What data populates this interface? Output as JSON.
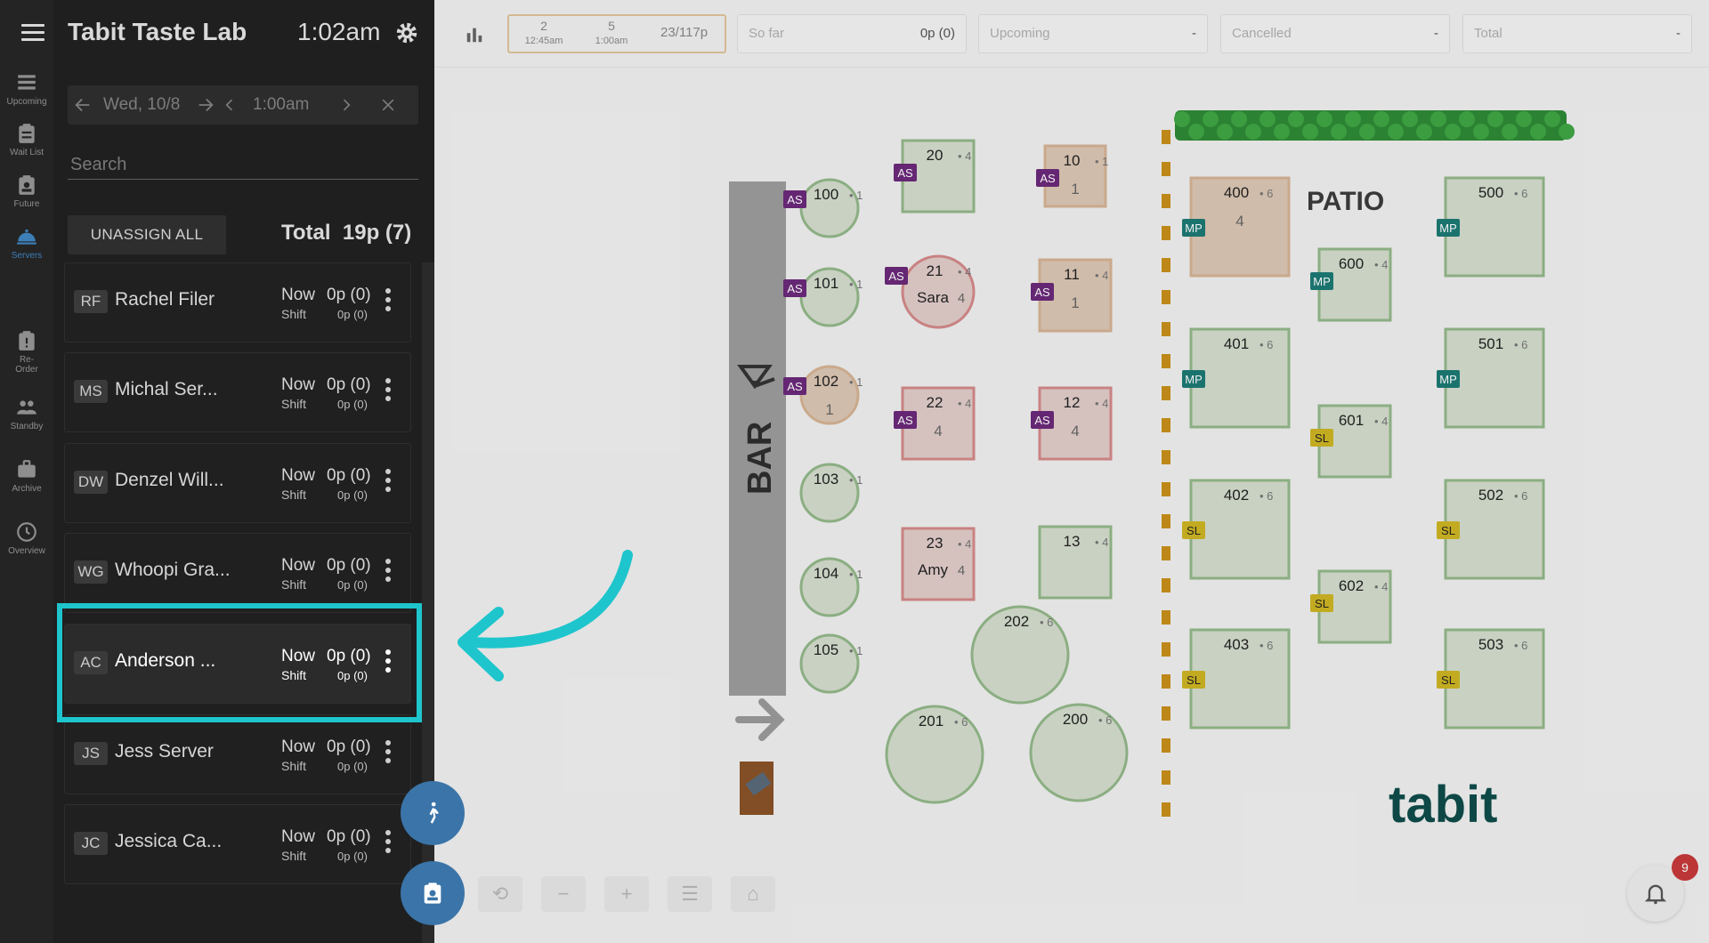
{
  "app": {
    "title": "Tabit Taste Lab",
    "time": "1:02am"
  },
  "rail": [
    {
      "label": "Upcoming",
      "icon": "list-icon"
    },
    {
      "label": "Wait List",
      "icon": "clipboard-icon"
    },
    {
      "label": "Future",
      "icon": "clipboard-user-icon"
    },
    {
      "label": "Servers",
      "icon": "cloche-icon",
      "active": true
    },
    {
      "label": "Re-Order",
      "icon": "clipboard-alert-icon"
    },
    {
      "label": "Standby",
      "icon": "people-icon"
    },
    {
      "label": "Archive",
      "icon": "briefcase-icon"
    },
    {
      "label": "Overview",
      "icon": "clock-icon"
    }
  ],
  "datebar": {
    "date": "Wed, 10/8",
    "time": "1:00am"
  },
  "search": {
    "placeholder": "Search"
  },
  "actions": {
    "unassign_all": "UNASSIGN ALL",
    "total_label": "Total",
    "total_value": "19p (7)"
  },
  "servers": [
    {
      "initials": "RF",
      "name": "Rachel Filer",
      "now_label": "Now",
      "now_value": "0p (0)",
      "shift_label": "Shift",
      "shift_value": "0p (0)"
    },
    {
      "initials": "MS",
      "name": "Michal Ser...",
      "now_label": "Now",
      "now_value": "0p (0)",
      "shift_label": "Shift",
      "shift_value": "0p (0)"
    },
    {
      "initials": "DW",
      "name": "Denzel Will...",
      "now_label": "Now",
      "now_value": "0p (0)",
      "shift_label": "Shift",
      "shift_value": "0p (0)"
    },
    {
      "initials": "WG",
      "name": "Whoopi Gra...",
      "now_label": "Now",
      "now_value": "0p (0)",
      "shift_label": "Shift",
      "shift_value": "0p (0)"
    },
    {
      "initials": "AC",
      "name": "Anderson ...",
      "now_label": "Now",
      "now_value": "0p (0)",
      "shift_label": "Shift",
      "shift_value": "0p (0)",
      "highlighted": true
    },
    {
      "initials": "JS",
      "name": "Jess Server",
      "now_label": "Now",
      "now_value": "0p (0)",
      "shift_label": "Shift",
      "shift_value": "0p (0)"
    },
    {
      "initials": "JC",
      "name": "Jessica Ca...",
      "now_label": "Now",
      "now_value": "0p (0)",
      "shift_label": "Shift",
      "shift_value": "0p (0)"
    }
  ],
  "statbar": {
    "slot1": {
      "count": "2",
      "time": "12:45am"
    },
    "slot2": {
      "count": "5",
      "time": "1:00am"
    },
    "covers": "23/117p",
    "so_far": {
      "label": "So far",
      "value": "0p (0)"
    },
    "upcoming": {
      "label": "Upcoming",
      "value": "-"
    },
    "cancelled": {
      "label": "Cancelled",
      "value": "-"
    },
    "total": {
      "label": "Total",
      "value": "-"
    }
  },
  "floor": {
    "bar_label": "BAR",
    "patio_label": "PATIO",
    "brand": "tabit",
    "tables": [
      {
        "id": "100",
        "seats": "1",
        "tag": "AS",
        "guest": "",
        "party": ""
      },
      {
        "id": "101",
        "seats": "1",
        "tag": "AS",
        "guest": "",
        "party": ""
      },
      {
        "id": "102",
        "seats": "1",
        "tag": "AS",
        "guest": "",
        "party": "1"
      },
      {
        "id": "103",
        "seats": "1",
        "tag": "",
        "guest": "",
        "party": ""
      },
      {
        "id": "104",
        "seats": "1",
        "tag": "",
        "guest": "",
        "party": ""
      },
      {
        "id": "105",
        "seats": "1",
        "tag": "",
        "guest": "",
        "party": ""
      },
      {
        "id": "20",
        "seats": "4",
        "tag": "AS",
        "guest": "",
        "party": ""
      },
      {
        "id": "21",
        "seats": "4",
        "tag": "AS",
        "guest": "Sara",
        "party": "4"
      },
      {
        "id": "22",
        "seats": "4",
        "tag": "AS",
        "guest": "",
        "party": "4"
      },
      {
        "id": "23",
        "seats": "4",
        "tag": "",
        "guest": "Amy",
        "party": "4"
      },
      {
        "id": "10",
        "seats": "1",
        "tag": "AS",
        "guest": "",
        "party": "1"
      },
      {
        "id": "11",
        "seats": "4",
        "tag": "AS",
        "guest": "",
        "party": "1"
      },
      {
        "id": "12",
        "seats": "4",
        "tag": "AS",
        "guest": "",
        "party": "4"
      },
      {
        "id": "13",
        "seats": "4",
        "tag": "",
        "guest": "",
        "party": ""
      },
      {
        "id": "202",
        "seats": "6",
        "tag": "",
        "guest": "",
        "party": ""
      },
      {
        "id": "201",
        "seats": "6",
        "tag": "",
        "guest": "",
        "party": ""
      },
      {
        "id": "200",
        "seats": "6",
        "tag": "",
        "guest": "",
        "party": ""
      },
      {
        "id": "400",
        "seats": "6",
        "tag": "MP",
        "guest": "",
        "party": "4"
      },
      {
        "id": "401",
        "seats": "6",
        "tag": "MP",
        "guest": "",
        "party": ""
      },
      {
        "id": "402",
        "seats": "6",
        "tag": "SL",
        "guest": "",
        "party": ""
      },
      {
        "id": "403",
        "seats": "6",
        "tag": "SL",
        "guest": "",
        "party": ""
      },
      {
        "id": "600",
        "seats": "4",
        "tag": "MP",
        "guest": "",
        "party": ""
      },
      {
        "id": "601",
        "seats": "4",
        "tag": "SL",
        "guest": "",
        "party": ""
      },
      {
        "id": "602",
        "seats": "4",
        "tag": "SL",
        "guest": "",
        "party": ""
      },
      {
        "id": "500",
        "seats": "6",
        "tag": "MP",
        "guest": "",
        "party": ""
      },
      {
        "id": "501",
        "seats": "6",
        "tag": "MP",
        "guest": "",
        "party": ""
      },
      {
        "id": "502",
        "seats": "6",
        "tag": "SL",
        "guest": "",
        "party": ""
      },
      {
        "id": "503",
        "seats": "6",
        "tag": "SL",
        "guest": "",
        "party": ""
      }
    ]
  },
  "notifications": {
    "count": "9"
  },
  "colors": {
    "highlight": "#1ec5cc",
    "as_tag": "#6b2a7a",
    "mp_tag": "#1d7a74",
    "sl_tag": "#cdb523",
    "table_green": "#93b88a",
    "table_orange": "#d5b394",
    "table_red": "#d48a8a",
    "fab": "#3a74a8"
  }
}
